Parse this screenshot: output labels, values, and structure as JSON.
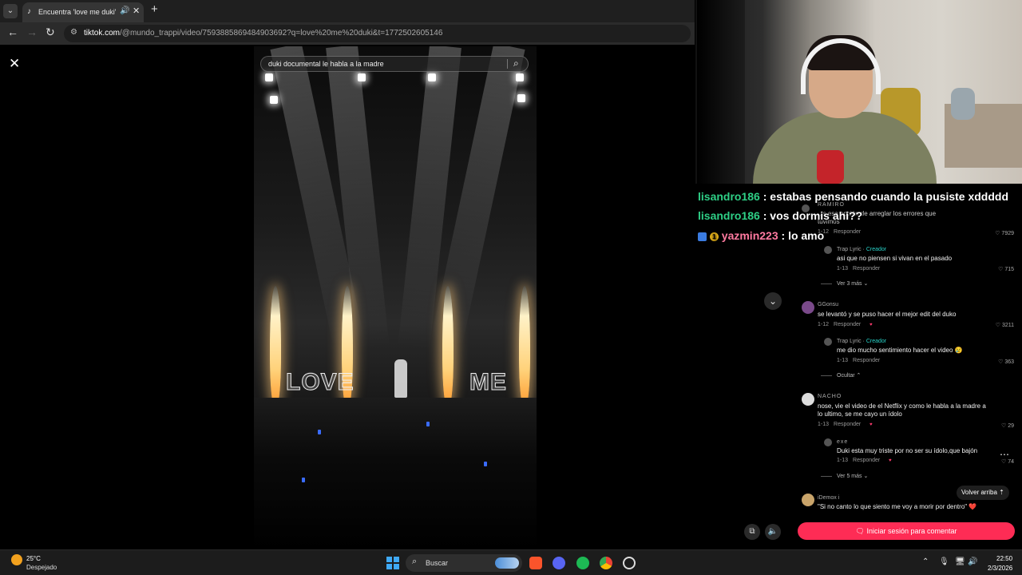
{
  "browser": {
    "tab_title": "Encuentra 'love me duki' en",
    "url_domain": "tiktok.com",
    "url_path": "/@mundo_trappi/video/7593885869484903692?q=love%20me%20duki&t=1772502605146"
  },
  "video": {
    "search_query": "duki documental le habla a la madre",
    "overlay_left": "LOVE",
    "overlay_right": "ME"
  },
  "stream_chat": [
    {
      "user": "lisandro186",
      "sep": " : ",
      "message": "estabas pensando cuando la pusiste xddddd",
      "color": "#2ecf86"
    },
    {
      "user": "lisandro186",
      "sep": " : ",
      "message": "vos dormis ahi??",
      "color": "#2ecf86"
    },
    {
      "user": "yazmin223",
      "sep": " : ",
      "message": "lo amo",
      "color": "#ff7aa0"
    }
  ],
  "comments": {
    "partial_top": {
      "user": "RAMIRO",
      "text": "...s esa opción de arreglar los errores que",
      "text2": "tuvimos",
      "date": "1-12",
      "reply": "Responder",
      "likes": "7929"
    },
    "reply1": {
      "user": "Trap Lyric",
      "creator_label": "Creador",
      "text": "asi que no piensen si vivan en el pasado",
      "date": "1-13",
      "reply": "Responder",
      "likes": "715"
    },
    "more1": "Ver 3 más",
    "c2": {
      "user": "GGonsu",
      "text": "se levantó y se puso hacer el mejor edit del duko",
      "date": "1-12",
      "reply": "Responder",
      "likes": "3211"
    },
    "reply2": {
      "user": "Trap Lyric",
      "creator_label": "Creador",
      "text": "me dio mucho sentimiento hacer el video 😢",
      "date": "1-13",
      "reply": "Responder",
      "likes": "363"
    },
    "hide": "Ocultar",
    "c3": {
      "user": "NACHO",
      "text": "nose, vie el video de el Netflix y como le habla a la madre a",
      "text2": "lo ultimo, se me cayo un ídolo",
      "date": "1-13",
      "reply": "Responder",
      "likes": "29"
    },
    "reply3": {
      "user": "exe",
      "text": "Duki esta muy triste por no ser su ídolo,que bajón",
      "date": "1-13",
      "reply": "Responder",
      "likes": "74"
    },
    "more2": "Ver 5 más",
    "c4": {
      "user": "iDemox i",
      "text": "\"Si no canto lo que siento me voy a morir por dentro\" ❤️"
    },
    "back_to_top": "Volver arriba",
    "login_button": "Iniciar sesión para comentar"
  },
  "taskbar": {
    "temperature": "25°C",
    "weather": "Despejado",
    "search_label": "Buscar",
    "time": "22:50",
    "date": "2/3/2026"
  },
  "colors": {
    "accent_pink": "#fe2c55",
    "creator_teal": "#28d2c8"
  }
}
